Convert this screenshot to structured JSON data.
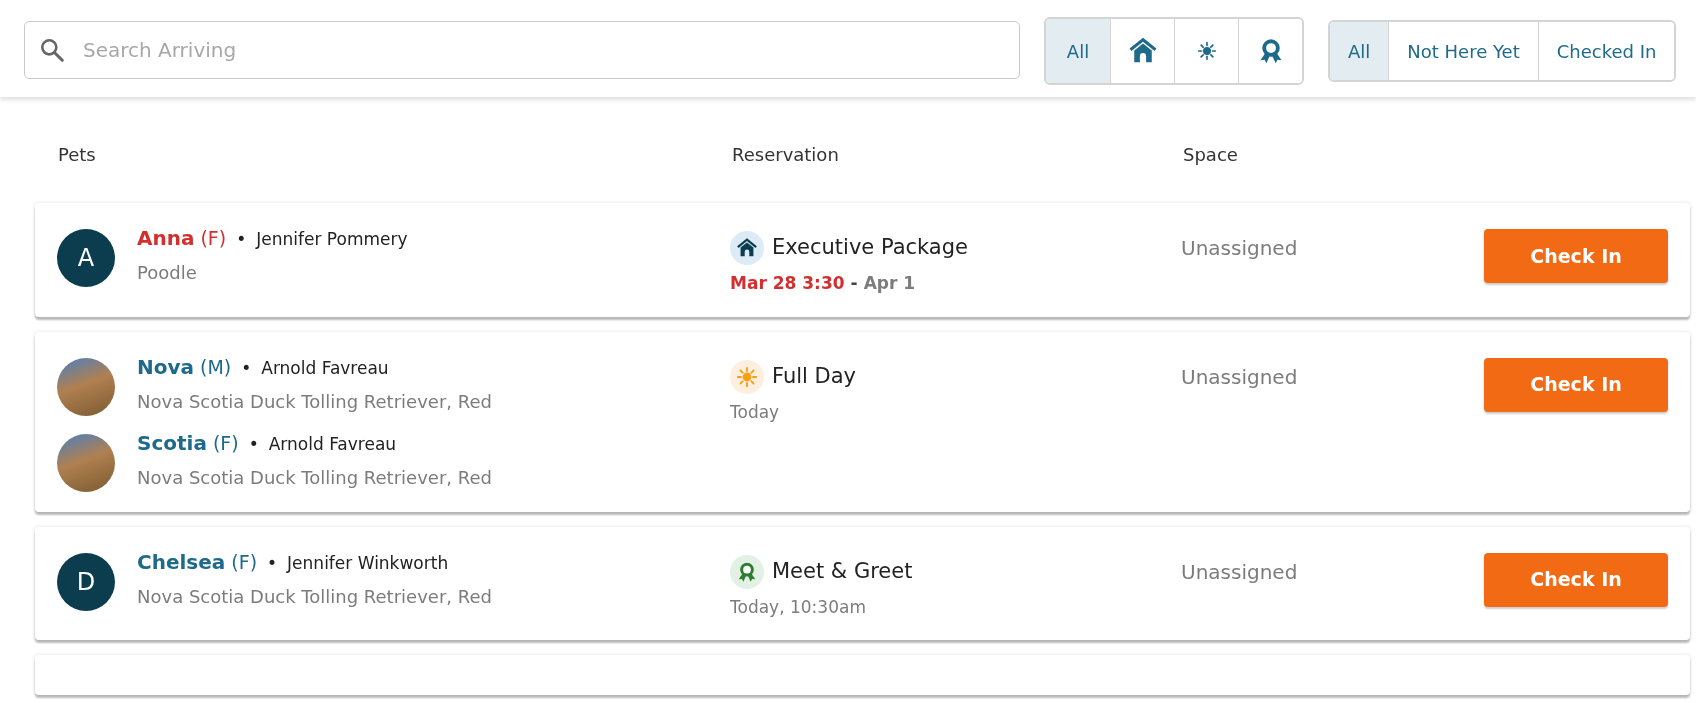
{
  "search": {
    "placeholder": "Search Arriving"
  },
  "type_filters": [
    {
      "kind": "all",
      "label": "All",
      "selected": true
    },
    {
      "kind": "boarding",
      "selected": false
    },
    {
      "kind": "daycare",
      "selected": false
    },
    {
      "kind": "training",
      "selected": false
    }
  ],
  "status_filters": [
    {
      "label": "All",
      "selected": true
    },
    {
      "label": "Not Here Yet",
      "selected": false
    },
    {
      "label": "Checked In",
      "selected": false
    }
  ],
  "columns": [
    "Pets",
    "Reservation",
    "Space"
  ],
  "reservations": [
    {
      "pets": [
        {
          "kind": "initial",
          "initial": "A",
          "name": "Anna",
          "sex": "(F)",
          "bullet": "•",
          "owner": "Jennifer Pommery",
          "breed": "Poodle",
          "overdue": true
        }
      ],
      "service": {
        "kind": "boarding",
        "name": "Executive Package"
      },
      "time": {
        "start": "Mar 28 3:30",
        "overdue": true,
        "separator": "-",
        "end": "Apr 1"
      },
      "space": "Unassigned",
      "action": "Check In"
    },
    {
      "pets": [
        {
          "kind": "photo",
          "name": "Nova",
          "sex": "(M)",
          "bullet": "•",
          "owner": "Arnold Favreau",
          "breed": "Nova Scotia Duck Tolling Retriever, Red",
          "overdue": false
        },
        {
          "kind": "photo",
          "name": "Scotia",
          "sex": "(F)",
          "bullet": "•",
          "owner": "Arnold Favreau",
          "breed": "Nova Scotia Duck Tolling Retriever, Red",
          "overdue": false
        }
      ],
      "service": {
        "kind": "daycare",
        "name": "Full Day"
      },
      "time": {
        "start": "Today",
        "overdue": false
      },
      "space": "Unassigned",
      "action": "Check In"
    },
    {
      "pets": [
        {
          "kind": "initial",
          "initial": "D",
          "name": "Chelsea",
          "sex": "(F)",
          "bullet": "•",
          "owner": "Jennifer Winkworth",
          "breed": "Nova Scotia Duck Tolling Retriever, Red",
          "overdue": false
        }
      ],
      "service": {
        "kind": "training",
        "name": "Meet & Greet"
      },
      "time": {
        "start": "Today, 10:30am",
        "overdue": false
      },
      "space": "Unassigned",
      "action": "Check In"
    }
  ]
}
